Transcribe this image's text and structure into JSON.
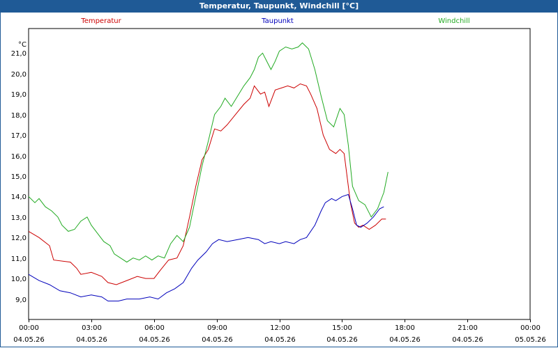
{
  "window": {
    "title": "Temperatur, Taupunkt, Windchill [°C]"
  },
  "chart_data": {
    "type": "line",
    "title": "Temperatur, Taupunkt, Windchill [°C]",
    "ylabel": "°C",
    "ylim": [
      8.0,
      22.2
    ],
    "xlim": [
      0,
      24
    ],
    "yticks": [
      "9,0",
      "10,0",
      "11,0",
      "12,0",
      "13,0",
      "14,0",
      "15,0",
      "16,0",
      "17,0",
      "18,0",
      "19,0",
      "20,0",
      "21,0"
    ],
    "yticks_values": [
      9,
      10,
      11,
      12,
      13,
      14,
      15,
      16,
      17,
      18,
      19,
      20,
      21
    ],
    "xticks": [
      {
        "time": "00:00",
        "date": "04.05.26"
      },
      {
        "time": "03:00",
        "date": "04.05.26"
      },
      {
        "time": "06:00",
        "date": "04.05.26"
      },
      {
        "time": "09:00",
        "date": "04.05.26"
      },
      {
        "time": "12:00",
        "date": "04.05.26"
      },
      {
        "time": "15:00",
        "date": "04.05.26"
      },
      {
        "time": "18:00",
        "date": "04.05.26"
      },
      {
        "time": "21:00",
        "date": "04.05.26"
      },
      {
        "time": "00:00",
        "date": "05.05.26"
      }
    ],
    "grid": true,
    "legend_placement": "top",
    "series": [
      {
        "name": "Temperatur",
        "color": "#cc0000",
        "points": [
          [
            0,
            12.3
          ],
          [
            0.5,
            12.0
          ],
          [
            1,
            11.6
          ],
          [
            1.2,
            10.9
          ],
          [
            2,
            10.8
          ],
          [
            2.3,
            10.5
          ],
          [
            2.5,
            10.2
          ],
          [
            3,
            10.3
          ],
          [
            3.5,
            10.1
          ],
          [
            3.8,
            9.8
          ],
          [
            4.2,
            9.7
          ],
          [
            4.7,
            9.9
          ],
          [
            5.2,
            10.1
          ],
          [
            5.6,
            10.0
          ],
          [
            6,
            10.0
          ],
          [
            6.3,
            10.4
          ],
          [
            6.7,
            10.9
          ],
          [
            7.1,
            11.0
          ],
          [
            7.4,
            11.6
          ],
          [
            7.7,
            13.0
          ],
          [
            8.0,
            14.5
          ],
          [
            8.3,
            15.8
          ],
          [
            8.6,
            16.3
          ],
          [
            8.9,
            17.3
          ],
          [
            9.2,
            17.2
          ],
          [
            9.5,
            17.5
          ],
          [
            9.9,
            18.0
          ],
          [
            10.3,
            18.5
          ],
          [
            10.6,
            18.8
          ],
          [
            10.8,
            19.4
          ],
          [
            11.1,
            19.0
          ],
          [
            11.3,
            19.1
          ],
          [
            11.5,
            18.4
          ],
          [
            11.8,
            19.2
          ],
          [
            12.1,
            19.3
          ],
          [
            12.4,
            19.4
          ],
          [
            12.7,
            19.3
          ],
          [
            13.0,
            19.5
          ],
          [
            13.3,
            19.4
          ],
          [
            13.5,
            19.0
          ],
          [
            13.8,
            18.3
          ],
          [
            14.1,
            17.0
          ],
          [
            14.4,
            16.3
          ],
          [
            14.7,
            16.1
          ],
          [
            14.9,
            16.3
          ],
          [
            15.1,
            16.1
          ],
          [
            15.4,
            13.7
          ],
          [
            15.6,
            12.7
          ],
          [
            15.8,
            12.5
          ],
          [
            16.0,
            12.6
          ],
          [
            16.3,
            12.4
          ],
          [
            16.6,
            12.6
          ],
          [
            16.9,
            12.9
          ],
          [
            17.1,
            12.9
          ]
        ]
      },
      {
        "name": "Taupunkt",
        "color": "#0000bb",
        "points": [
          [
            0,
            10.2
          ],
          [
            0.5,
            9.9
          ],
          [
            1,
            9.7
          ],
          [
            1.5,
            9.4
          ],
          [
            2,
            9.3
          ],
          [
            2.5,
            9.1
          ],
          [
            3,
            9.2
          ],
          [
            3.5,
            9.1
          ],
          [
            3.8,
            8.9
          ],
          [
            4.3,
            8.9
          ],
          [
            4.7,
            9.0
          ],
          [
            5.3,
            9.0
          ],
          [
            5.8,
            9.1
          ],
          [
            6.2,
            9.0
          ],
          [
            6.6,
            9.3
          ],
          [
            7.0,
            9.5
          ],
          [
            7.4,
            9.8
          ],
          [
            7.8,
            10.5
          ],
          [
            8.1,
            10.9
          ],
          [
            8.5,
            11.3
          ],
          [
            8.8,
            11.7
          ],
          [
            9.1,
            11.9
          ],
          [
            9.5,
            11.8
          ],
          [
            10.0,
            11.9
          ],
          [
            10.5,
            12.0
          ],
          [
            11.0,
            11.9
          ],
          [
            11.3,
            11.7
          ],
          [
            11.6,
            11.8
          ],
          [
            12.0,
            11.7
          ],
          [
            12.3,
            11.8
          ],
          [
            12.7,
            11.7
          ],
          [
            13.0,
            11.9
          ],
          [
            13.3,
            12.0
          ],
          [
            13.7,
            12.6
          ],
          [
            14.0,
            13.3
          ],
          [
            14.2,
            13.7
          ],
          [
            14.5,
            13.9
          ],
          [
            14.7,
            13.8
          ],
          [
            15.0,
            14.0
          ],
          [
            15.3,
            14.1
          ],
          [
            15.5,
            13.4
          ],
          [
            15.7,
            12.6
          ],
          [
            15.9,
            12.5
          ],
          [
            16.2,
            12.7
          ],
          [
            16.5,
            13.0
          ],
          [
            16.8,
            13.4
          ],
          [
            17.0,
            13.5
          ]
        ]
      },
      {
        "name": "Windchill",
        "color": "#22aa22",
        "points": [
          [
            0,
            14.0
          ],
          [
            0.3,
            13.7
          ],
          [
            0.5,
            13.9
          ],
          [
            0.8,
            13.5
          ],
          [
            1.1,
            13.3
          ],
          [
            1.4,
            13.0
          ],
          [
            1.6,
            12.6
          ],
          [
            1.9,
            12.3
          ],
          [
            2.2,
            12.4
          ],
          [
            2.5,
            12.8
          ],
          [
            2.8,
            13.0
          ],
          [
            3.0,
            12.6
          ],
          [
            3.3,
            12.2
          ],
          [
            3.6,
            11.8
          ],
          [
            3.9,
            11.6
          ],
          [
            4.1,
            11.2
          ],
          [
            4.4,
            11.0
          ],
          [
            4.7,
            10.8
          ],
          [
            5.0,
            11.0
          ],
          [
            5.3,
            10.9
          ],
          [
            5.6,
            11.1
          ],
          [
            5.9,
            10.9
          ],
          [
            6.2,
            11.1
          ],
          [
            6.5,
            11.0
          ],
          [
            6.8,
            11.7
          ],
          [
            7.1,
            12.1
          ],
          [
            7.4,
            11.8
          ],
          [
            7.7,
            12.5
          ],
          [
            8.0,
            14.0
          ],
          [
            8.3,
            15.5
          ],
          [
            8.6,
            16.7
          ],
          [
            8.9,
            18.0
          ],
          [
            9.2,
            18.4
          ],
          [
            9.4,
            18.8
          ],
          [
            9.7,
            18.4
          ],
          [
            10.0,
            18.9
          ],
          [
            10.3,
            19.4
          ],
          [
            10.6,
            19.8
          ],
          [
            10.8,
            20.2
          ],
          [
            11.0,
            20.8
          ],
          [
            11.2,
            21.0
          ],
          [
            11.4,
            20.6
          ],
          [
            11.6,
            20.2
          ],
          [
            11.8,
            20.6
          ],
          [
            12.0,
            21.1
          ],
          [
            12.3,
            21.3
          ],
          [
            12.6,
            21.2
          ],
          [
            12.9,
            21.3
          ],
          [
            13.1,
            21.5
          ],
          [
            13.4,
            21.2
          ],
          [
            13.7,
            20.2
          ],
          [
            14.0,
            18.9
          ],
          [
            14.3,
            17.7
          ],
          [
            14.6,
            17.4
          ],
          [
            14.9,
            18.3
          ],
          [
            15.1,
            18.0
          ],
          [
            15.3,
            16.5
          ],
          [
            15.5,
            14.5
          ],
          [
            15.8,
            13.8
          ],
          [
            16.1,
            13.6
          ],
          [
            16.4,
            13.0
          ],
          [
            16.7,
            13.4
          ],
          [
            17.0,
            14.2
          ],
          [
            17.2,
            15.2
          ]
        ]
      }
    ]
  }
}
